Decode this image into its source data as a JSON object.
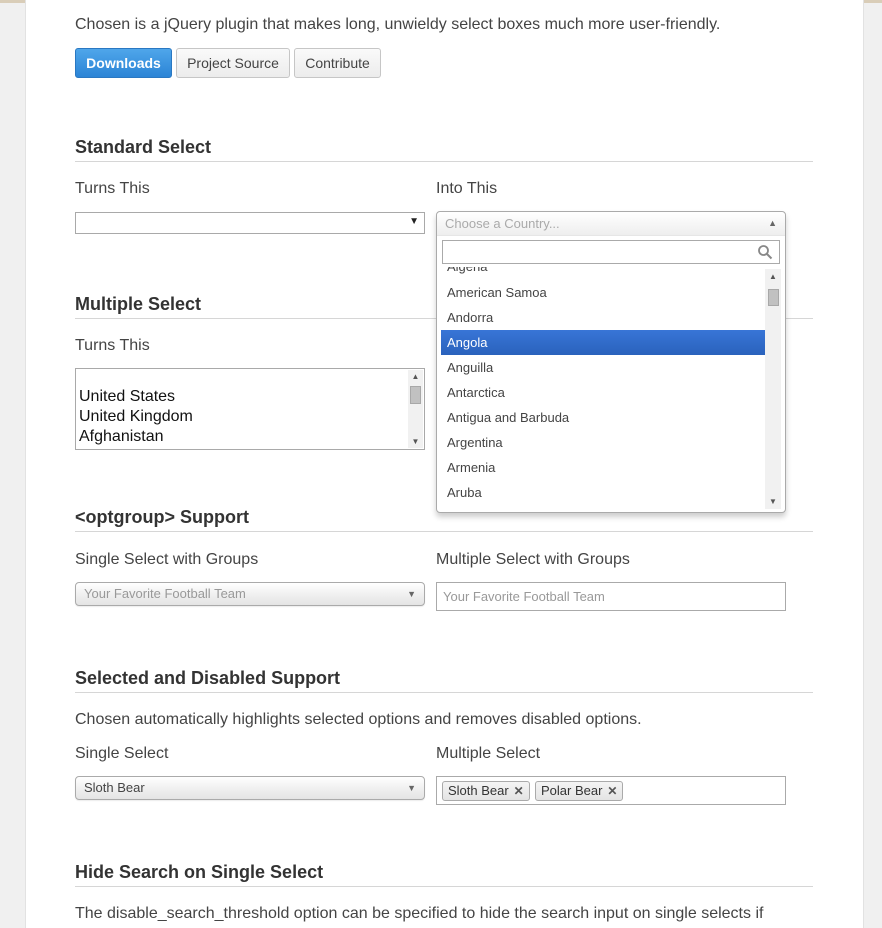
{
  "intro": "Chosen is a jQuery plugin that makes long, unwieldy select boxes much more user-friendly.",
  "buttons": {
    "downloads": "Downloads",
    "project_source": "Project Source",
    "contribute": "Contribute"
  },
  "colors": {
    "accent": "#2b84d6",
    "highlight": "#3875d7"
  },
  "standard": {
    "heading": "Standard Select",
    "turns_this": "Turns This",
    "into_this": "Into This",
    "placeholder": "Choose a Country...",
    "results": [
      "Algeria",
      "American Samoa",
      "Andorra",
      "Angola",
      "Anguilla",
      "Antarctica",
      "Antigua and Barbuda",
      "Argentina",
      "Armenia",
      "Aruba"
    ],
    "highlighted": "Angola"
  },
  "multiple": {
    "heading": "Multiple Select",
    "turns_this": "Turns This",
    "options": [
      "United States",
      "United Kingdom",
      "Afghanistan"
    ]
  },
  "optgroup": {
    "heading": "<optgroup> Support",
    "single_label": "Single Select with Groups",
    "multi_label": "Multiple Select with Groups",
    "single_placeholder": "Your Favorite Football Team",
    "multi_placeholder": "Your Favorite Football Team"
  },
  "selected": {
    "heading": "Selected and Disabled Support",
    "description": "Chosen automatically highlights selected options and removes disabled options.",
    "single_label": "Single Select",
    "multi_label": "Multiple Select",
    "single_value": "Sloth Bear",
    "tags": [
      "Sloth Bear",
      "Polar Bear"
    ],
    "tag_close": "✕"
  },
  "hide_search": {
    "heading": "Hide Search on Single Select",
    "description": "The disable_search_threshold option can be specified to hide the search input on single selects if"
  },
  "icons": {
    "caret_down": "▼",
    "caret_up": "▲"
  }
}
